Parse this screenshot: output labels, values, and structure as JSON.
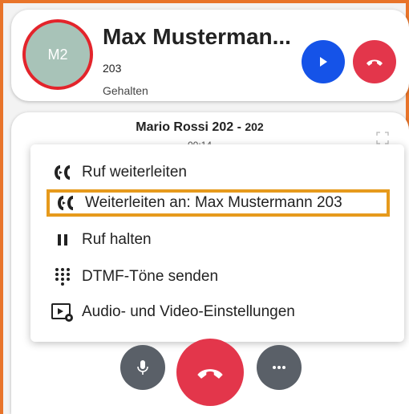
{
  "held_call": {
    "avatar_initials": "M2",
    "name": "Max Musterman...",
    "extension": "203",
    "status": "Gehalten"
  },
  "active_call": {
    "title": "Mario Rossi 202 - ",
    "title_ext": "202",
    "timer": "00:14"
  },
  "menu": {
    "items": [
      {
        "label": "Ruf weiterleiten",
        "icon": "transfer-icon"
      },
      {
        "label": "Weiterleiten an: Max Mustermann 203",
        "icon": "transfer-icon"
      },
      {
        "label": "Ruf halten",
        "icon": "pause-icon"
      },
      {
        "label": "DTMF-Töne senden",
        "icon": "dialpad-icon"
      },
      {
        "label": "Audio- und Video-Einstellungen",
        "icon": "av-settings-icon"
      }
    ]
  },
  "colors": {
    "accent_orange": "#e8742a",
    "highlight": "#e69a1c",
    "resume_blue": "#1553e8",
    "hangup_red": "#e3364b",
    "control_gray": "#5a6068"
  }
}
